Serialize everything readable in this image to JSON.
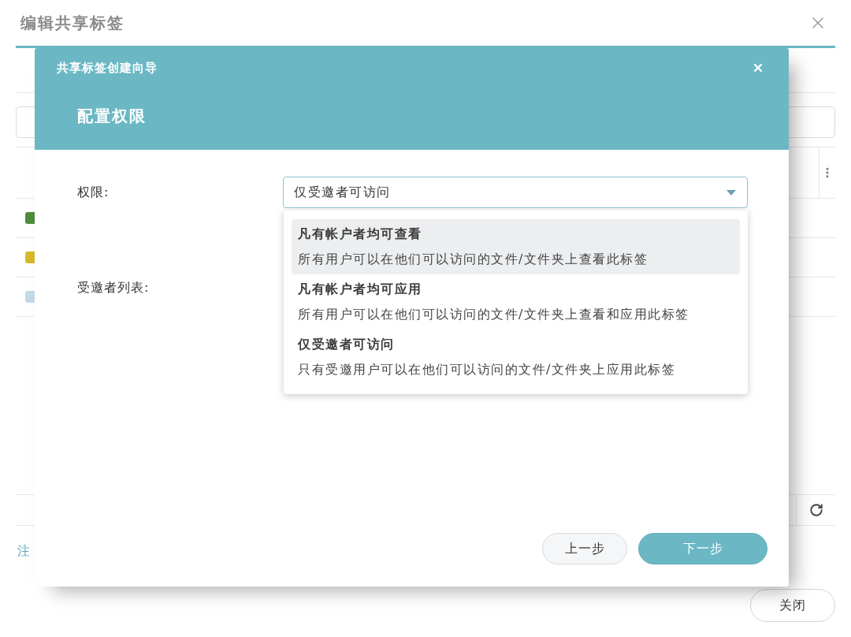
{
  "background_window": {
    "title": "编辑共享标签",
    "tag_rows": [
      {
        "color": "#4f8b3b"
      },
      {
        "color": "#d6b92b"
      },
      {
        "color": "#c3d9e6"
      }
    ],
    "note_link": "注",
    "close_button": "关闭"
  },
  "dialog": {
    "title": "共享标签创建向导",
    "step_title": "配置权限",
    "fields": [
      {
        "kind": "select",
        "label": "权限:",
        "value": "仅受邀者可访问",
        "expanded": true,
        "options": [
          {
            "title": "凡有帐户者均可查看",
            "description": "所有用户可以在他们可以访问的文件/文件夹上查看此标签",
            "highlighted": true
          },
          {
            "title": "凡有帐户者均可应用",
            "description": "所有用户可以在他们可以访问的文件/文件夹上查看和应用此标签",
            "highlighted": false
          },
          {
            "title": "仅受邀者可访问",
            "description": "只有受邀用户可以在他们可以访问的文件/文件夹上应用此标签",
            "highlighted": false
          }
        ]
      },
      {
        "kind": "list",
        "label": "受邀者列表:"
      }
    ],
    "buttons": [
      {
        "label": "上一步",
        "kind": "secondary"
      },
      {
        "label": "下一步",
        "kind": "primary"
      }
    ]
  }
}
